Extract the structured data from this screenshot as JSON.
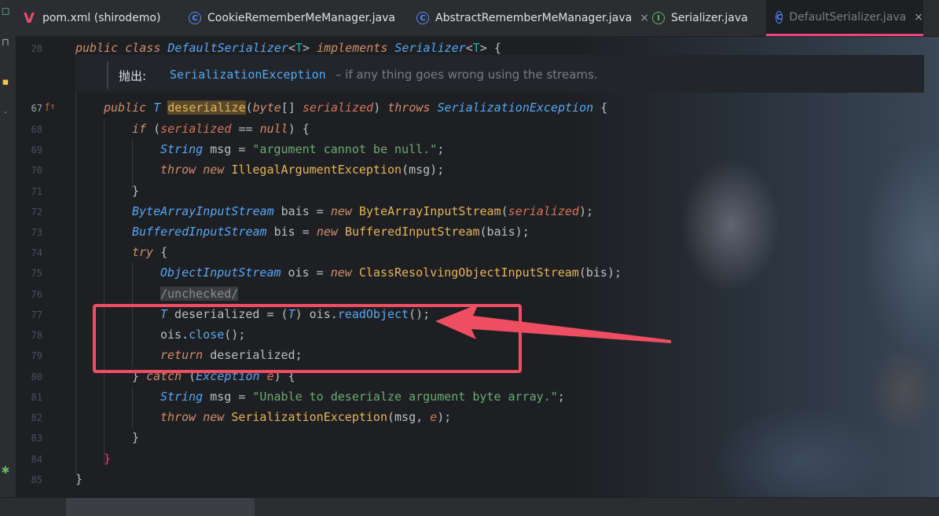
{
  "tabs": [
    {
      "label": "pom.xml (shirodemo)",
      "icon": "maven-icon"
    },
    {
      "label": "CookieRememberMeManager.java",
      "icon": "class-icon"
    },
    {
      "label": "AbstractRememberMeManager.java",
      "icon": "class-icon",
      "close": "×"
    },
    {
      "label": "Serializer.java",
      "icon": "interface-icon"
    },
    {
      "label": "DefaultSerializer.java",
      "icon": "class-icon",
      "close": "×",
      "active": true
    }
  ],
  "tab_icon_glyphs": {
    "class": "C",
    "interface": "I",
    "maven": "V"
  },
  "doc": {
    "label": "抛出:",
    "exception": "SerializationException",
    "description": "– if any thing goes wrong using the streams."
  },
  "line_numbers": [
    "28",
    "67",
    "68",
    "69",
    "70",
    "71",
    "72",
    "73",
    "74",
    "75",
    "76",
    "77",
    "78",
    "79",
    "80",
    "81",
    "82",
    "83",
    "84",
    "85"
  ],
  "code": {
    "l28": {
      "kw1": "public",
      "kw2": "class",
      "name": "DefaultSerializer",
      "lt": "<",
      "tp": "T",
      "gt": ">",
      "impl": "implements",
      "iface": "Serializer",
      "lt2": "<",
      "tp2": "T",
      "gt2": ">",
      "brace": " {"
    },
    "l67": {
      "kw": "public",
      "t": "T",
      "fn": "deserialize",
      "open": "(",
      "ty": "byte",
      "arr": "[] ",
      "param": "serialized",
      "close": ")",
      "throws": "throws",
      "exc": "SerializationException",
      "brace": " {"
    },
    "l68": {
      "kw": "if",
      "open": " (",
      "param": "serialized",
      "op": " == ",
      "nul": "null",
      "close": ") {"
    },
    "l69": {
      "ty": "String",
      "rest": " msg = ",
      "str": "\"argument cannot be null.\"",
      "end": ";"
    },
    "l70": {
      "kw": "throw",
      "kw2": "new",
      "cls": "IllegalArgumentException",
      "args": "(msg);"
    },
    "l71": {
      "text": "}"
    },
    "l72": {
      "ty": "ByteArrayInputStream",
      "rest": " bais = ",
      "kw": "new",
      "cls": "ByteArrayInputStream",
      "open": "(",
      "param": "serialized",
      "close": ");"
    },
    "l73": {
      "ty": "BufferedInputStream",
      "rest": " bis = ",
      "kw": "new",
      "cls": "BufferedInputStream",
      "args": "(bais);"
    },
    "l74": {
      "kw": "try",
      "brace": " {"
    },
    "l75": {
      "ty": "ObjectInputStream",
      "rest": " ois = ",
      "kw": "new",
      "cls": "ClassResolvingObjectInputStream",
      "args": "(bis);"
    },
    "l76": {
      "text": "/unchecked/"
    },
    "l77": {
      "t": "T",
      "rest": " deserialized = (",
      "t2": "T",
      "rest2": ") ois.",
      "method": "readObject",
      "end": "();"
    },
    "l78": {
      "rest": "ois.",
      "method": "close",
      "end": "();"
    },
    "l79": {
      "kw": "return",
      "rest": " deserialized;"
    },
    "l80": {
      "brace": "} ",
      "kw": "catch",
      "open": " (",
      "ty": "Exception",
      "param": " e",
      "close": ") {"
    },
    "l81": {
      "ty": "String",
      "rest": " msg = ",
      "str": "\"Unable to deserialze argument byte array.\"",
      "end": ";"
    },
    "l82": {
      "kw": "throw",
      "kw2": "new",
      "cls": "SerializationException",
      "args": "(msg, ",
      "param": "e",
      "end": ");"
    },
    "l83": {
      "text": "}"
    },
    "l84": {
      "text": "}"
    },
    "l85": {
      "text": "}"
    }
  },
  "colors": {
    "accent": "#e8467c",
    "annotation_red": "#ee4e62"
  }
}
